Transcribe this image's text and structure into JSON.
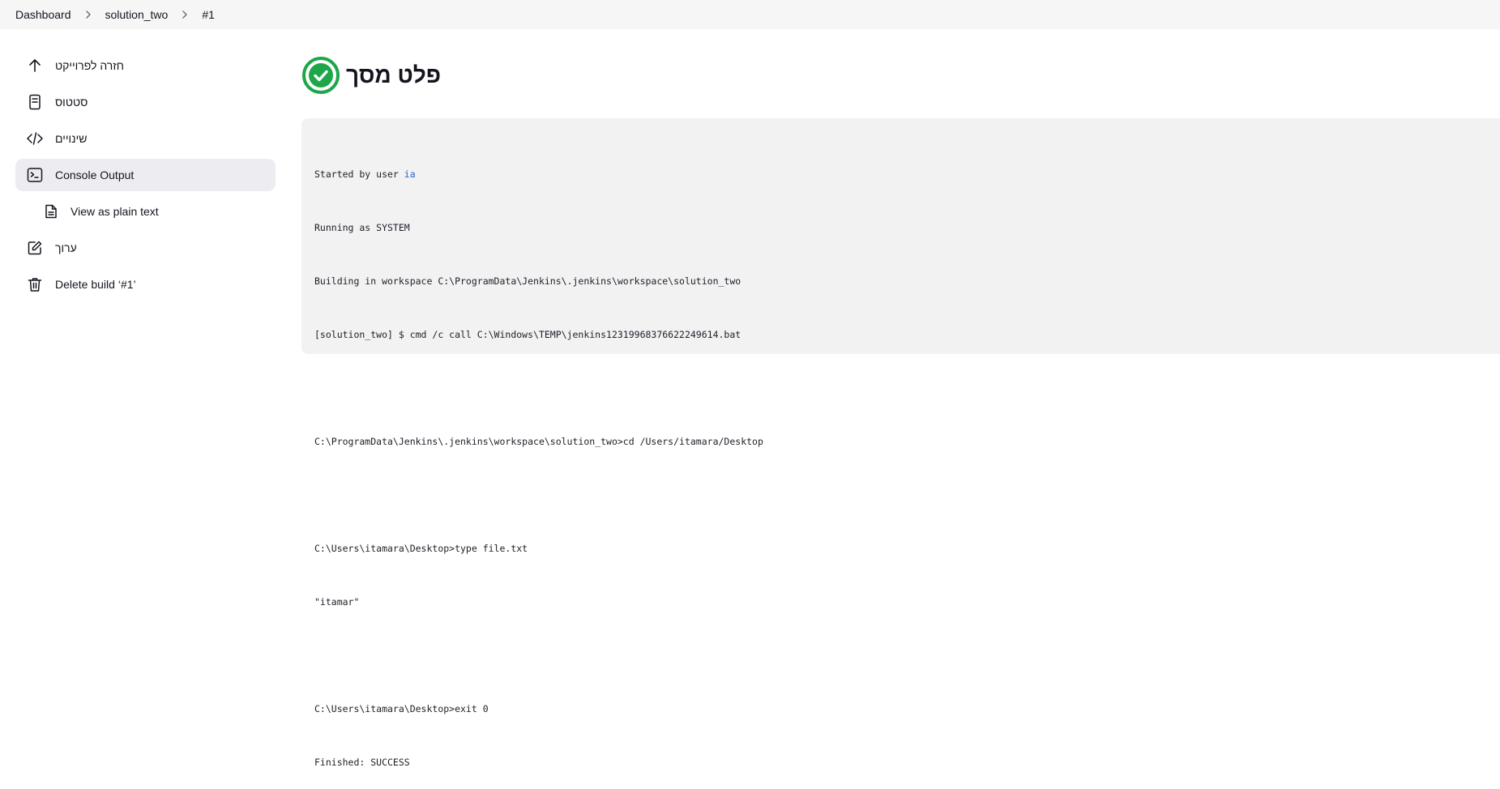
{
  "breadcrumb": {
    "items": [
      "Dashboard",
      "solution_two",
      "#1"
    ]
  },
  "sidebar": {
    "items": [
      {
        "label": "חזרה לפרוייקט",
        "icon": "arrow-up-icon"
      },
      {
        "label": "סטטוס",
        "icon": "document-icon"
      },
      {
        "label": "שינויים",
        "icon": "code-icon"
      },
      {
        "label": "Console Output",
        "icon": "terminal-icon",
        "active": true
      },
      {
        "label": "View as plain text",
        "icon": "file-icon"
      },
      {
        "label": "ערוך",
        "icon": "edit-icon"
      },
      {
        "label": "Delete build ‘#1’",
        "icon": "trash-icon"
      }
    ]
  },
  "main": {
    "title": "פלט מסך",
    "status_icon": "success-check-icon",
    "status_color": "#1ea64b"
  },
  "console": {
    "started_prefix": "Started by user ",
    "user": "ia",
    "lines": [
      "Running as SYSTEM",
      "Building in workspace C:\\ProgramData\\Jenkins\\.jenkins\\workspace\\solution_two",
      "[solution_two] $ cmd /c call C:\\Windows\\TEMP\\jenkins12319968376622249614.bat",
      "",
      "C:\\ProgramData\\Jenkins\\.jenkins\\workspace\\solution_two>cd /Users/itamara/Desktop",
      "",
      "C:\\Users\\itamara\\Desktop>type file.txt",
      "\"itamar\"",
      "",
      "C:\\Users\\itamara\\Desktop>exit 0",
      "Finished: SUCCESS"
    ]
  },
  "colors": {
    "link": "#1a66d6",
    "success": "#1ea64b"
  }
}
